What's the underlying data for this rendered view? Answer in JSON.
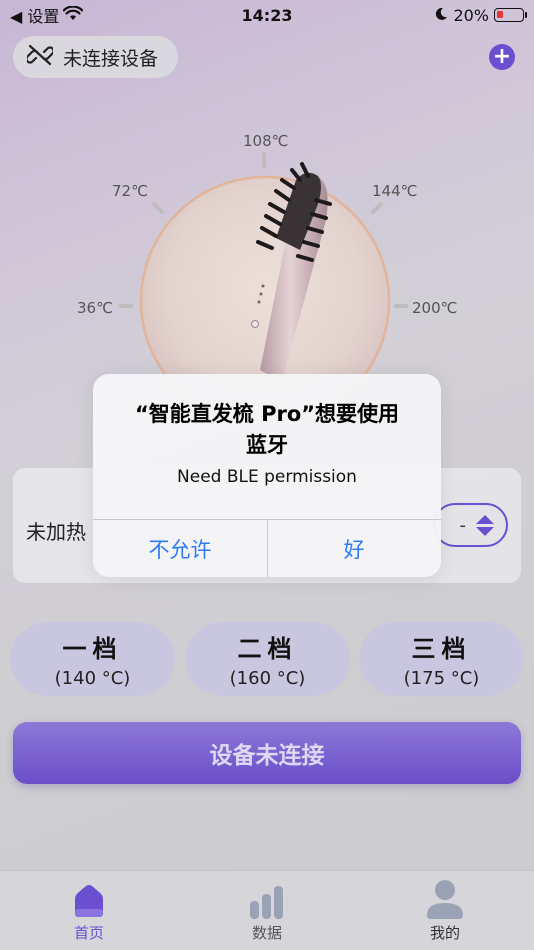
{
  "status_bar": {
    "back_label": "◀ 设置",
    "time": "14:23",
    "battery_percent": "20%"
  },
  "header": {
    "connection_status": "未连接设备",
    "add_icon": "plus-icon"
  },
  "dial": {
    "tick_labels": [
      "36℃",
      "72℃",
      "108℃",
      "144℃",
      "200℃"
    ]
  },
  "heat_card": {
    "status_label": "未加热",
    "stepper_value": "-"
  },
  "gears": [
    {
      "name": "一档",
      "temp": "(140 °C)"
    },
    {
      "name": "二档",
      "temp": "(160 °C)"
    },
    {
      "name": "三档",
      "temp": "(175 °C)"
    }
  ],
  "main_button": {
    "label": "设备未连接"
  },
  "tabbar": {
    "tabs": [
      {
        "label": "首页",
        "icon": "home-icon",
        "active": true
      },
      {
        "label": "数据",
        "icon": "bar-chart-icon",
        "active": false
      },
      {
        "label": "我的",
        "icon": "user-icon",
        "active": false
      }
    ]
  },
  "alert": {
    "title_line1": "“智能直发梳 Pro”想要使用",
    "title_line2": "蓝牙",
    "message": "Need BLE permission",
    "deny_label": "不允许",
    "allow_label": "好"
  },
  "colors": {
    "accent": "#6a4fd0",
    "alert_button": "#2f7bf5",
    "battery_low": "#e53935"
  }
}
